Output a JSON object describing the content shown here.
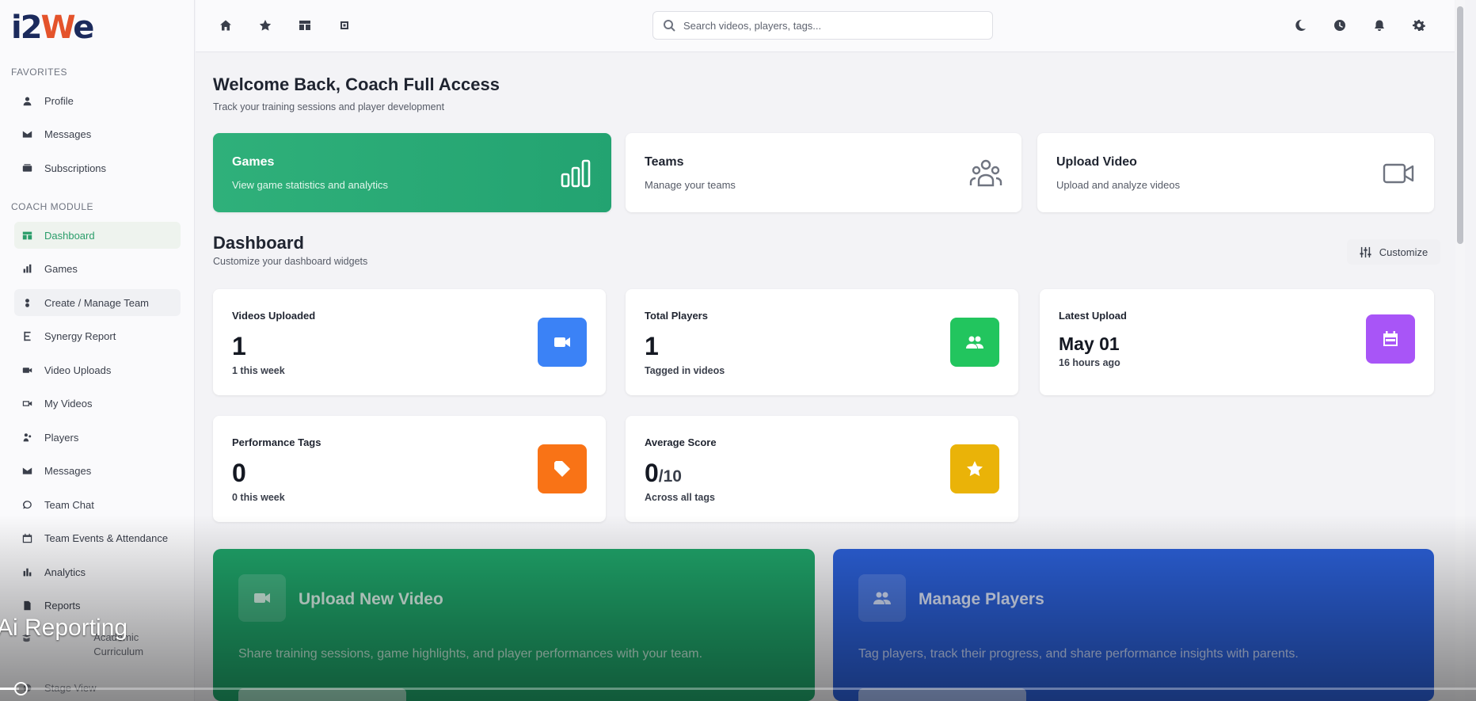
{
  "logo": {
    "main": "i2",
    "accent": "W",
    "tail": "e"
  },
  "sidebar": {
    "favorites_title": "FAVORITES",
    "favorites": [
      {
        "label": "Profile",
        "icon": "user-icon"
      },
      {
        "label": "Messages",
        "icon": "mail-icon"
      },
      {
        "label": "Subscriptions",
        "icon": "subscriptions-icon"
      }
    ],
    "coach_title": "COACH MODULE",
    "coach": [
      {
        "label": "Dashboard",
        "icon": "dashboard-icon"
      },
      {
        "label": "Games",
        "icon": "chart-icon"
      },
      {
        "label": "Create / Manage Team",
        "icon": "team-icon"
      },
      {
        "label": "Synergy Report",
        "icon": "report-icon"
      },
      {
        "label": "Video Uploads",
        "icon": "video-icon"
      },
      {
        "label": "My Videos",
        "icon": "video-outline-icon"
      },
      {
        "label": "Players",
        "icon": "players-icon"
      },
      {
        "label": "Messages",
        "icon": "mail-icon"
      },
      {
        "label": "Team Chat",
        "icon": "chat-icon"
      },
      {
        "label": "Team Events & Attendance",
        "icon": "calendar-icon"
      },
      {
        "label": "Analytics",
        "icon": "analytics-icon"
      },
      {
        "label": "Reports",
        "icon": "reports-icon"
      },
      {
        "label": "Academic Curriculum",
        "icon": "curriculum-icon"
      },
      {
        "label": "Stage View",
        "icon": "stage-icon"
      }
    ]
  },
  "topbar": {
    "search_placeholder": "Search videos, players, tags..."
  },
  "main": {
    "welcome": "Welcome Back, Coach Full Access",
    "welcome_sub": "Track your training sessions and player development",
    "quick": [
      {
        "title": "Games",
        "desc": "View game statistics and analytics"
      },
      {
        "title": "Teams",
        "desc": "Manage your teams"
      },
      {
        "title": "Upload Video",
        "desc": "Upload and analyze videos"
      }
    ],
    "dashboard_title": "Dashboard",
    "dashboard_sub": "Customize your dashboard widgets",
    "customize_label": "Customize",
    "stats": [
      {
        "label": "Videos Uploaded",
        "value": "1",
        "note": "1 this week",
        "color": "#3b82f6"
      },
      {
        "label": "Total Players",
        "value": "1",
        "note": "Tagged in videos",
        "color": "#22c55e"
      },
      {
        "label": "Latest Upload",
        "value": "May 01",
        "note": "16 hours ago",
        "color": "#a855f7"
      },
      {
        "label": "Performance Tags",
        "value": "0",
        "note": "0 this week",
        "color": "#f97316"
      },
      {
        "label": "Average Score",
        "value": "0",
        "denom": "/10",
        "note": "Across all tags",
        "color": "#eab308"
      }
    ],
    "promos": [
      {
        "title": "Upload New Video",
        "desc": "Share training sessions, game highlights, and player performances with your team."
      },
      {
        "title": "Manage Players",
        "desc": "Tag players, track their progress, and share performance insights with parents."
      }
    ]
  },
  "overlay": {
    "caption": "Ai Reporting"
  }
}
